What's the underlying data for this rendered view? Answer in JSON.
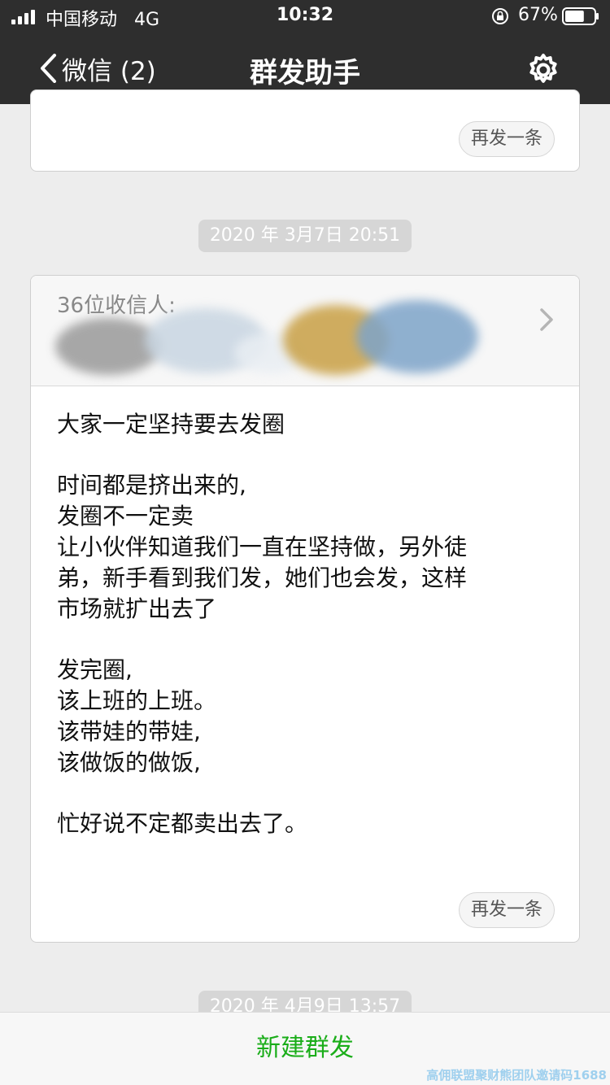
{
  "status_bar": {
    "carrier": "中国移动",
    "network": "4G",
    "time": "10:32",
    "battery_percent": "67%",
    "battery_level": 0.67
  },
  "nav": {
    "back_label": "微信 (2)",
    "title": "群发助手",
    "settings_icon": "gear-icon"
  },
  "messages": [
    {
      "resend_label": "再发一条"
    },
    {
      "date": "2020 年 3月7日 20:51",
      "recipients_label": "36位收信人:",
      "body": [
        [
          "大家一定坚持要去发圈"
        ],
        [
          "时间都是挤出来的,",
          "发圈不一定卖",
          "让小伙伴知道我们一直在坚持做，另外徒",
          "弟，新手看到我们发，她们也会发，这样",
          "市场就扩出去了"
        ],
        [
          "发完圈,",
          "该上班的上班。",
          "该带娃的带娃,",
          "该做饭的做饭,"
        ],
        [
          "忙好说不定都卖出去了。"
        ]
      ],
      "resend_label": "再发一条"
    },
    {
      "date": "2020 年 4月9日 13:57"
    }
  ],
  "footer": {
    "new_button_label": "新建群发",
    "accent_color": "#1aad19"
  },
  "watermark": "高佣联盟聚财熊团队邀请码1688"
}
